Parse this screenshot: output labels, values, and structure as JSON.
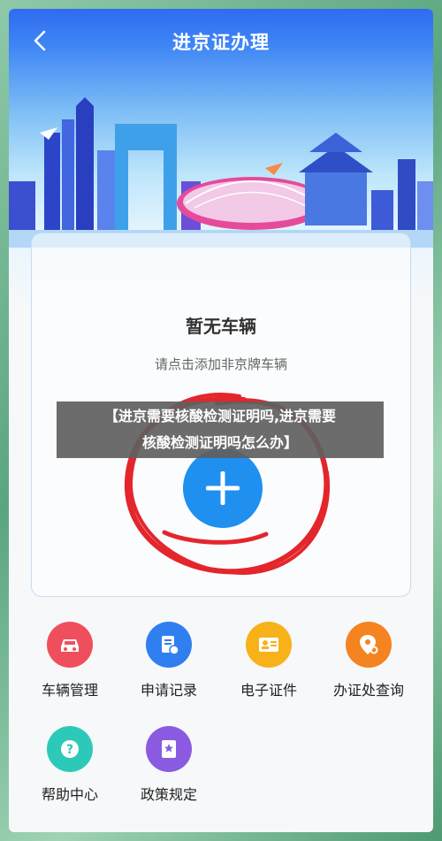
{
  "header": {
    "title": "进京证办理"
  },
  "card": {
    "no_vehicle": "暂无车辆",
    "hint": "请点击添加非京牌车辆"
  },
  "banner": {
    "line1": "【进京需要核酸检测证明吗,进京需要",
    "line2": "核酸检测证明吗怎么办】"
  },
  "menu": [
    {
      "label": "车辆管理",
      "icon": "car-icon",
      "color": "#ef4f5c"
    },
    {
      "label": "申请记录",
      "icon": "document-record-icon",
      "color": "#2f7ff0"
    },
    {
      "label": "电子证件",
      "icon": "id-card-icon",
      "color": "#f7b21a"
    },
    {
      "label": "办证处查询",
      "icon": "location-search-icon",
      "color": "#f5831f"
    },
    {
      "label": "帮助中心",
      "icon": "help-icon",
      "color": "#2cc9b8"
    },
    {
      "label": "政策规定",
      "icon": "policy-book-icon",
      "color": "#8a5be0"
    }
  ]
}
